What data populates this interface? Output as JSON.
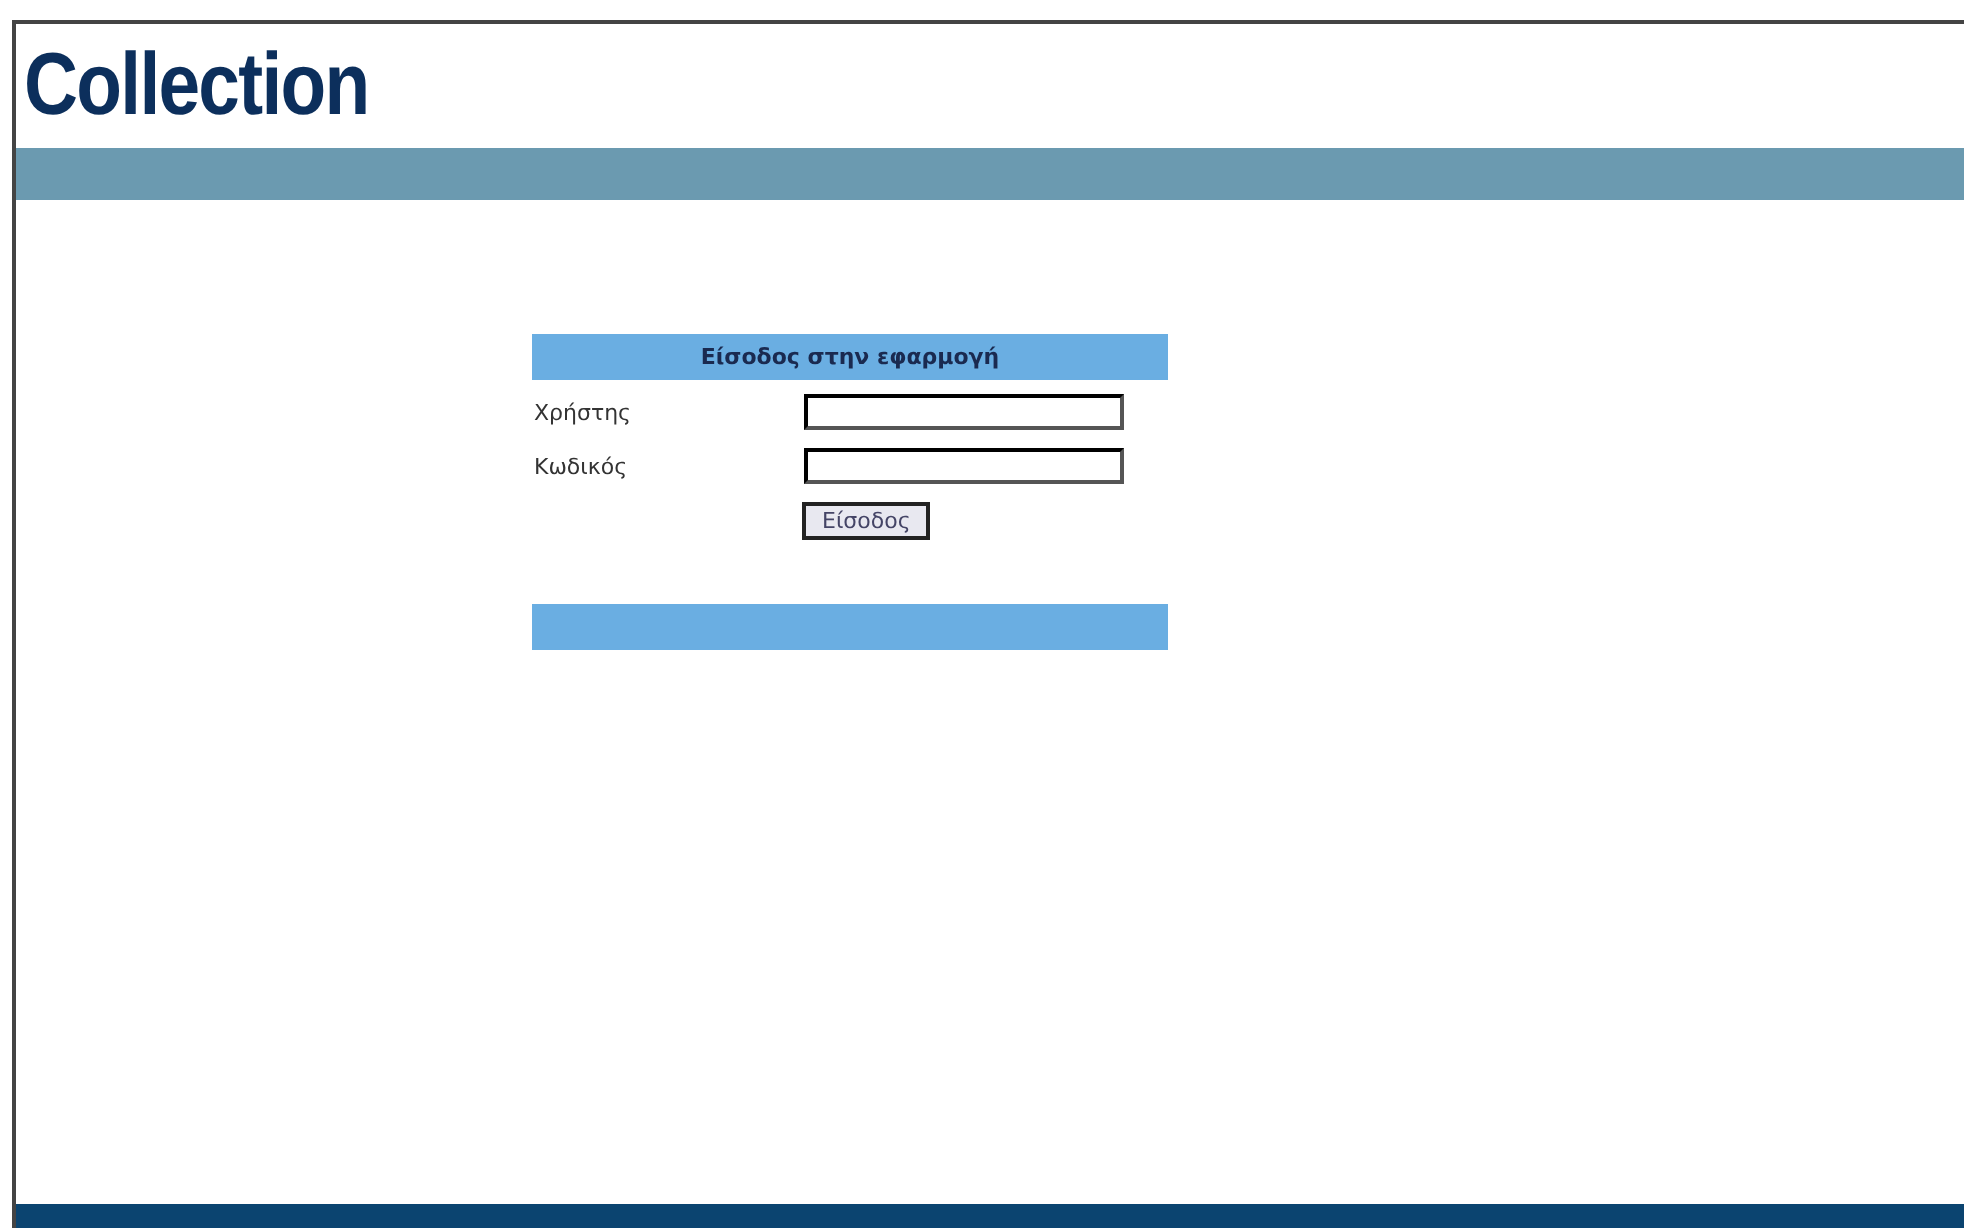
{
  "header": {
    "title": "Collection"
  },
  "login": {
    "title": "Είσοδος στην εφαρμογή",
    "fields": [
      {
        "label": "Χρήστης"
      },
      {
        "label": "Κωδικός"
      }
    ],
    "button": "Είσοδος"
  }
}
